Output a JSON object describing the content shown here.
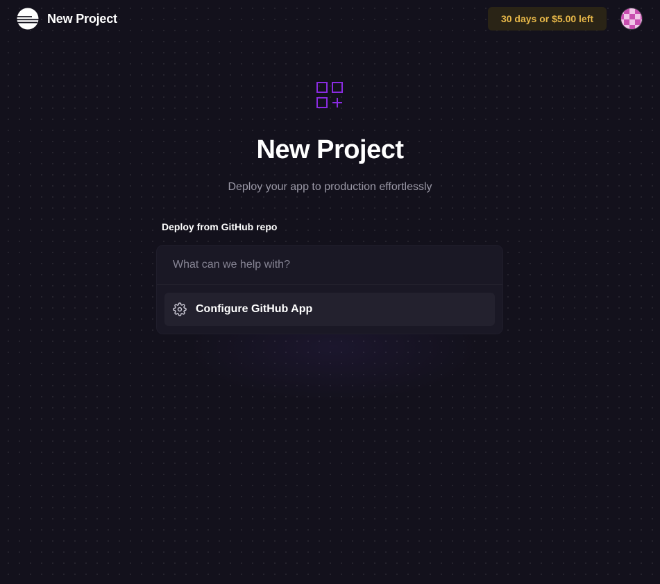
{
  "header": {
    "title": "New Project",
    "logo_icon": "railway-logo-icon",
    "trial_badge": "30 days or $5.00 left",
    "avatar_icon": "user-avatar"
  },
  "main": {
    "hero_icon": "grid-plus-icon",
    "title": "New Project",
    "subtitle": "Deploy your app to production effortlessly",
    "section_label": "Deploy from GitHub repo",
    "search": {
      "placeholder": "What can we help with?",
      "value": ""
    },
    "options": [
      {
        "label": "Configure GitHub App",
        "icon": "gear-icon"
      }
    ]
  },
  "colors": {
    "background": "#13111c",
    "accent": "#8a2be2",
    "badge_text": "#e9b949",
    "badge_bg": "#2a2416",
    "card_bg": "#1a1825"
  }
}
